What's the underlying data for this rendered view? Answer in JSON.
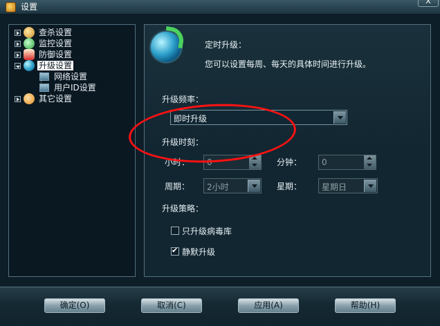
{
  "window": {
    "title": "设置",
    "close_label": "X"
  },
  "tree": {
    "items": [
      {
        "label": "查杀设置",
        "icon": "scan-icon"
      },
      {
        "label": "监控设置",
        "icon": "monitor-icon"
      },
      {
        "label": "防御设置",
        "icon": "defense-icon"
      },
      {
        "label": "升级设置",
        "icon": "update-icon",
        "selected": true,
        "children": [
          {
            "label": "网络设置"
          },
          {
            "label": "用户ID设置"
          }
        ]
      },
      {
        "label": "其它设置",
        "icon": "other-icon"
      }
    ]
  },
  "content": {
    "title": "定时升级：",
    "description": "您可以设置每周、每天的具体时间进行升级。",
    "frequency_label": "升级频率：",
    "frequency_value": "即时升级",
    "time_label": "升级时刻：",
    "hour_label": "小时：",
    "hour_value": "0",
    "minute_label": "分钟：",
    "minute_value": "0",
    "period_label": "周期：",
    "period_value": "2小时",
    "weekday_label": "星期：",
    "weekday_value": "星期日",
    "strategy_label": "升级策略：",
    "only_virus_db_label": "只升级病毒库",
    "only_virus_db_checked": false,
    "silent_update_label": "静默升级",
    "silent_update_checked": true
  },
  "buttons": {
    "ok": "确定(O)",
    "cancel": "取消(C)",
    "apply": "应用(A)",
    "help": "帮助(H)"
  },
  "colors": {
    "background": "#0e1e28",
    "panel_border": "#54707e",
    "annotation": "#ff1212"
  }
}
